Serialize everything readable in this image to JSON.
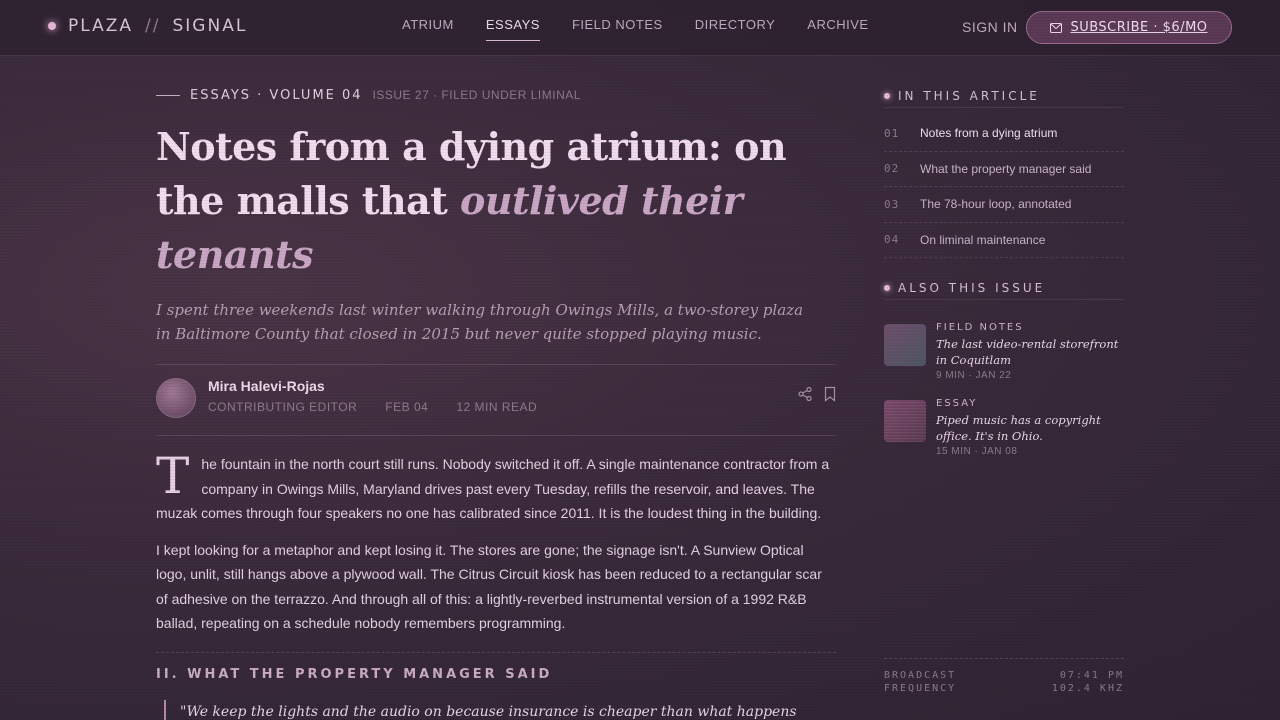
{
  "brand": {
    "name_left": "PLAZA",
    "separator": "//",
    "name_right": "SIGNAL"
  },
  "nav": {
    "items": [
      {
        "label": "ATRIUM",
        "active": false
      },
      {
        "label": "ESSAYS",
        "active": true
      },
      {
        "label": "FIELD NOTES",
        "active": false
      },
      {
        "label": "DIRECTORY",
        "active": false
      },
      {
        "label": "ARCHIVE",
        "active": false
      }
    ]
  },
  "header": {
    "signin_label": "SIGN IN",
    "subscribe_label": "SUBSCRIBE · $6/MO"
  },
  "article": {
    "kicker": "ESSAYS · VOLUME 04",
    "kicker_meta": "ISSUE 27 · FILED UNDER LIMINAL",
    "title_main": "Notes from a dying atrium: on the malls that ",
    "title_em": "outlived their tenants",
    "dek": "I spent three weekends last winter walking through Owings Mills, a two-storey plaza in Baltimore County that closed in 2015 but never quite stopped playing music.",
    "author": "Mira Halevi-Rojas",
    "role": "CONTRIBUTING EDITOR",
    "date": "FEB 04",
    "read_time": "12 MIN READ",
    "dropcap": "T",
    "para1": "he fountain in the north court still runs. Nobody switched it off. A single maintenance contractor from a company in Owings Mills, Maryland drives past every Tuesday, refills the reservoir, and leaves. The muzak comes through four speakers no one has calibrated since 2011. It is the loudest thing in the building.",
    "para2": "I kept looking for a metaphor and kept losing it. The stores are gone; the signage isn't. A Sunview Optical logo, unlit, still hangs above a plywood wall. The Citrus Circuit kiosk has been reduced to a rectangular scar of adhesive on the terrazzo. And through all of this: a lightly-reverbed instrumental version of a 1992 R&B ballad, repeating on a schedule nobody remembers programming.",
    "section2": "II. WHAT THE PROPERTY MANAGER SAID",
    "quote": "\"We keep the lights and the audio on because insurance is cheaper than what happens when a place looks abandoned.\""
  },
  "sidebar": {
    "toc_heading": "IN THIS ARTICLE",
    "toc": [
      {
        "num": "01",
        "title": "Notes from a dying atrium",
        "active": true
      },
      {
        "num": "02",
        "title": "What the property manager said",
        "active": false
      },
      {
        "num": "03",
        "title": "The 78-hour loop, annotated",
        "active": false
      },
      {
        "num": "04",
        "title": "On liminal maintenance",
        "active": false
      }
    ],
    "also_heading": "ALSO THIS ISSUE",
    "also": [
      {
        "category": "FIELD NOTES",
        "title": "The last video-rental storefront in Coquitlam",
        "meta": "9 MIN · JAN 22"
      },
      {
        "category": "ESSAY",
        "title": "Piped music has a copyright office. It's in Ohio.",
        "meta": "15 MIN · JAN 08"
      }
    ],
    "broadcast": {
      "label1": "BROADCAST",
      "value1": "07:41 PM",
      "label2": "FREQUENCY",
      "value2": "102.4 KHZ"
    }
  },
  "colors": {
    "accent": "#e6b6d8",
    "background": "#3a2a3b",
    "button": "#5a3a55"
  },
  "icons": {
    "subscribe": "mail-icon",
    "share": "share-icon",
    "bookmark": "bookmark-icon"
  }
}
